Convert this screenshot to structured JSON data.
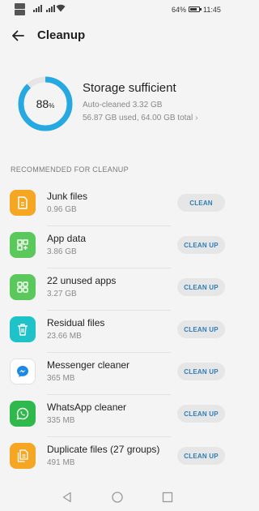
{
  "status_bar": {
    "battery": "64%",
    "battery_level": 0.64,
    "time": "11:45"
  },
  "app_bar": {
    "title": "Cleanup",
    "back_icon": "arrow-left-icon"
  },
  "summary": {
    "percent": "88",
    "percent_unit": "%",
    "percent_value": 88,
    "title": "Storage sufficient",
    "auto_cleaned": "Auto-cleaned 3.32 GB",
    "usage": "56.87 GB used, 64.00 GB total",
    "ring_color": "#26a8e0"
  },
  "section": {
    "header": "RECOMMENDED FOR CLEANUP"
  },
  "items": [
    {
      "name": "Junk files",
      "size": "0.96 GB",
      "button": "CLEAN",
      "icon": "document-icon",
      "color": "#f5a623"
    },
    {
      "name": "App data",
      "size": "3.86 GB",
      "button": "CLEAN UP",
      "icon": "app-data-icon",
      "color": "#5ac85a"
    },
    {
      "name": "22 unused apps",
      "size": "3.27 GB",
      "button": "CLEAN UP",
      "icon": "apps-grid-icon",
      "color": "#5ac85a"
    },
    {
      "name": "Residual files",
      "size": "23.66 MB",
      "button": "CLEAN UP",
      "icon": "trash-icon",
      "color": "#1fc2c9"
    },
    {
      "name": "Messenger cleaner",
      "size": "365 MB",
      "button": "CLEAN UP",
      "icon": "messenger-icon",
      "color": "#ffffff"
    },
    {
      "name": "WhatsApp cleaner",
      "size": "335 MB",
      "button": "CLEAN UP",
      "icon": "whatsapp-icon",
      "color": "#2fb84c"
    },
    {
      "name": "Duplicate files (27 groups)",
      "size": "491 MB",
      "button": "CLEAN UP",
      "icon": "duplicate-files-icon",
      "color": "#f5a623"
    }
  ],
  "nav_bar": {
    "back_icon": "nav-back-icon",
    "home_icon": "nav-home-icon",
    "recents_icon": "nav-recents-icon"
  }
}
